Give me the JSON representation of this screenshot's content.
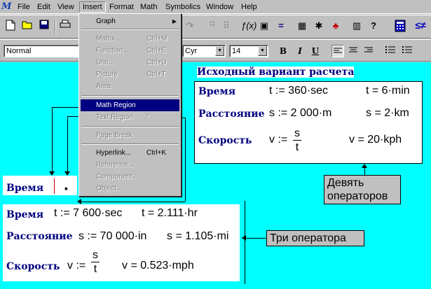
{
  "menubar": {
    "app_logo": "M",
    "items": [
      "File",
      "Edit",
      "View",
      "Insert",
      "Format",
      "Math",
      "Symbolics",
      "Window",
      "Help"
    ]
  },
  "toolbar": {
    "icons": [
      "new-icon",
      "open-icon",
      "save-icon",
      "print-icon",
      "redo-icon",
      "align-icon",
      "calculator-icon",
      "greater-equal-icon"
    ]
  },
  "format_bar": {
    "style": "Normal",
    "font_suffix": "Cyr",
    "size": "14",
    "bold": "B",
    "italic": "I",
    "underline": "U"
  },
  "insert_menu": {
    "items": [
      {
        "label": "Graph",
        "shortcut": "",
        "disabled": false,
        "submenu": true
      },
      {
        "label": "Matrix...",
        "shortcut": "Ctrl+M",
        "disabled": true
      },
      {
        "label": "Function...",
        "shortcut": "Ctrl+E",
        "disabled": true
      },
      {
        "label": "Unit...",
        "shortcut": "Ctrl+U",
        "disabled": true
      },
      {
        "label": "Picture",
        "shortcut": "Ctrl+T",
        "disabled": true
      },
      {
        "label": "Area",
        "shortcut": "",
        "disabled": true
      },
      {
        "label": "Math Region",
        "shortcut": "",
        "disabled": false,
        "highlighted": true
      },
      {
        "label": "Text Region",
        "shortcut": "\"",
        "disabled": true
      },
      {
        "label": "Page Break",
        "shortcut": "",
        "disabled": true
      },
      {
        "label": "Hyperlink...",
        "shortcut": "Ctrl+K",
        "disabled": false
      },
      {
        "label": "Reference...",
        "shortcut": "",
        "disabled": true
      },
      {
        "label": "Component...",
        "shortcut": "",
        "disabled": true
      },
      {
        "label": "Object...",
        "shortcut": "",
        "disabled": true
      }
    ]
  },
  "original": {
    "heading": "Исходный вариант расчета",
    "time_label": "Время",
    "time_def": "t := 360·sec",
    "time_result": "t = 6·min",
    "distance_label": "Расстояние",
    "distance_def": "s := 2 000·m",
    "distance_result": "s = 2·km",
    "speed_label": "Скорость",
    "speed_var": "v :=",
    "speed_num": "s",
    "speed_den": "t",
    "speed_result": "v = 20·kph"
  },
  "callouts": {
    "nine_ops": "Девять операторов",
    "three_ops": "Три оператора"
  },
  "editing": {
    "label": "Время",
    "cursor": "▪"
  },
  "new_calc": {
    "time_label": "Время",
    "time_def": "t := 7 600·sec",
    "time_result": "t = 2.111·hr",
    "distance_label": "Расстояние",
    "distance_def": "s := 70 000·in",
    "distance_result": "s = 1.105·mi",
    "speed_label": "Скорость",
    "speed_var": "v :=",
    "speed_num": "s",
    "speed_den": "t",
    "speed_result": "v = 0.523·mph"
  }
}
